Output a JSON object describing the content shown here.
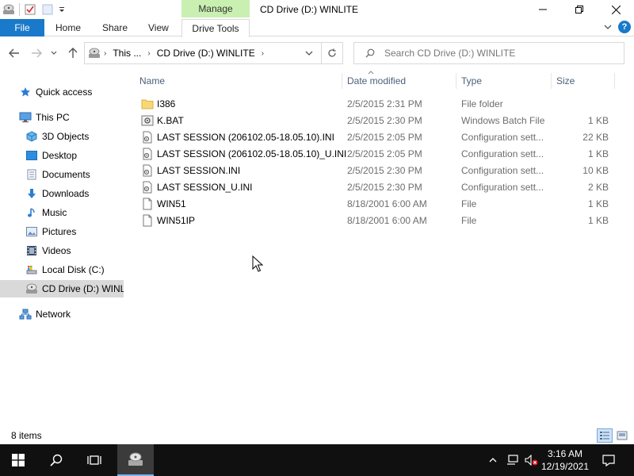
{
  "window": {
    "title": "CD Drive (D:) WINLITE",
    "contextual_tab_group": "Manage"
  },
  "ribbon": {
    "file_tab": "File",
    "tabs": [
      "Home",
      "Share",
      "View"
    ],
    "contextual_tab": "Drive Tools"
  },
  "address": {
    "crumb_1": "This ...",
    "crumb_2": "CD Drive (D:) WINLITE",
    "search_placeholder": "Search CD Drive (D:) WINLITE"
  },
  "sidebar": {
    "items": [
      {
        "label": "Quick access",
        "icon": "star-icon"
      },
      {
        "label": "This PC",
        "icon": "computer-icon"
      },
      {
        "label": "3D Objects",
        "icon": "cube-icon"
      },
      {
        "label": "Desktop",
        "icon": "desktop-icon"
      },
      {
        "label": "Documents",
        "icon": "documents-icon"
      },
      {
        "label": "Downloads",
        "icon": "download-arrow-icon"
      },
      {
        "label": "Music",
        "icon": "music-note-icon"
      },
      {
        "label": "Pictures",
        "icon": "pictures-icon"
      },
      {
        "label": "Videos",
        "icon": "film-icon"
      },
      {
        "label": "Local Disk (C:)",
        "icon": "local-disk-icon"
      },
      {
        "label": "CD Drive (D:) WINLI",
        "icon": "cd-drive-icon",
        "selected": true
      },
      {
        "label": "Network",
        "icon": "network-icon"
      }
    ]
  },
  "columns": {
    "name": "Name",
    "date": "Date modified",
    "type": "Type",
    "size": "Size"
  },
  "files": [
    {
      "name": "I386",
      "date": "2/5/2015 2:31 PM",
      "type": "File folder",
      "size": "",
      "icon": "folder-icon"
    },
    {
      "name": "K.BAT",
      "date": "2/5/2015 2:30 PM",
      "type": "Windows Batch File",
      "size": "1 KB",
      "icon": "batch-file-icon"
    },
    {
      "name": "LAST SESSION (206102.05-18.05.10).INI",
      "date": "2/5/2015 2:05 PM",
      "type": "Configuration sett...",
      "size": "22 KB",
      "icon": "config-file-icon"
    },
    {
      "name": "LAST SESSION (206102.05-18.05.10)_U.INI",
      "date": "2/5/2015 2:05 PM",
      "type": "Configuration sett...",
      "size": "1 KB",
      "icon": "config-file-icon"
    },
    {
      "name": "LAST SESSION.INI",
      "date": "2/5/2015 2:30 PM",
      "type": "Configuration sett...",
      "size": "10 KB",
      "icon": "config-file-icon"
    },
    {
      "name": "LAST SESSION_U.INI",
      "date": "2/5/2015 2:30 PM",
      "type": "Configuration sett...",
      "size": "2 KB",
      "icon": "config-file-icon"
    },
    {
      "name": "WIN51",
      "date": "8/18/2001 6:00 AM",
      "type": "File",
      "size": "1 KB",
      "icon": "blank-file-icon"
    },
    {
      "name": "WIN51IP",
      "date": "8/18/2001 6:00 AM",
      "type": "File",
      "size": "1 KB",
      "icon": "blank-file-icon"
    }
  ],
  "status": {
    "item_count": "8 items"
  },
  "taskbar": {
    "time": "3:16 AM",
    "date": "12/19/2021"
  },
  "colors": {
    "file_tab": "#1979ca",
    "manage_tab": "#c9f0b1",
    "taskbar": "#101010",
    "selected_nav": "#d9d9d9"
  }
}
